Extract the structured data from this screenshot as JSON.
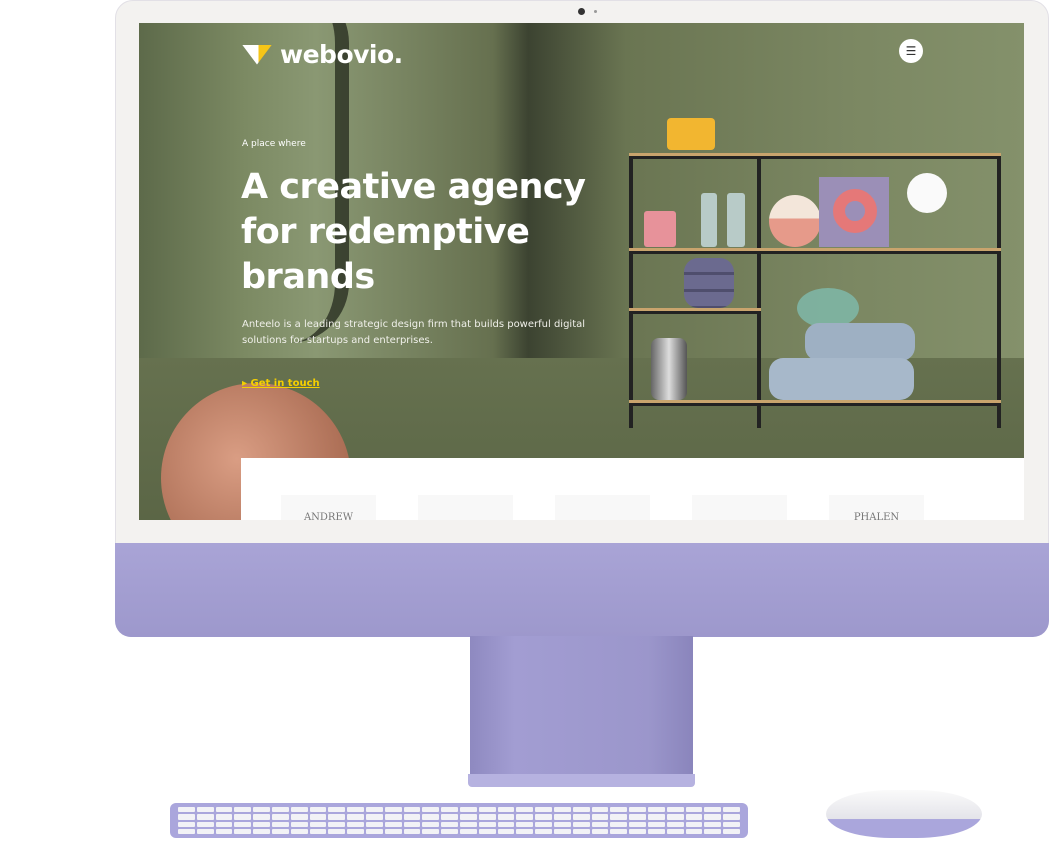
{
  "site": {
    "logo_text": "webovio.",
    "menu_icon": "hamburger-icon",
    "eyebrow": "A place where",
    "headline": "A creative agency for redemptive brands",
    "description": "Anteelo is a leading strategic design firm that builds powerful digital solutions for startups and enterprises.",
    "cta_label": "Get in touch",
    "cta_color": "#f5d000",
    "brand_logos": [
      "ANDREW",
      "",
      "",
      "",
      "PHALEN"
    ]
  },
  "device": {
    "chin_color": "#a29dd2"
  }
}
